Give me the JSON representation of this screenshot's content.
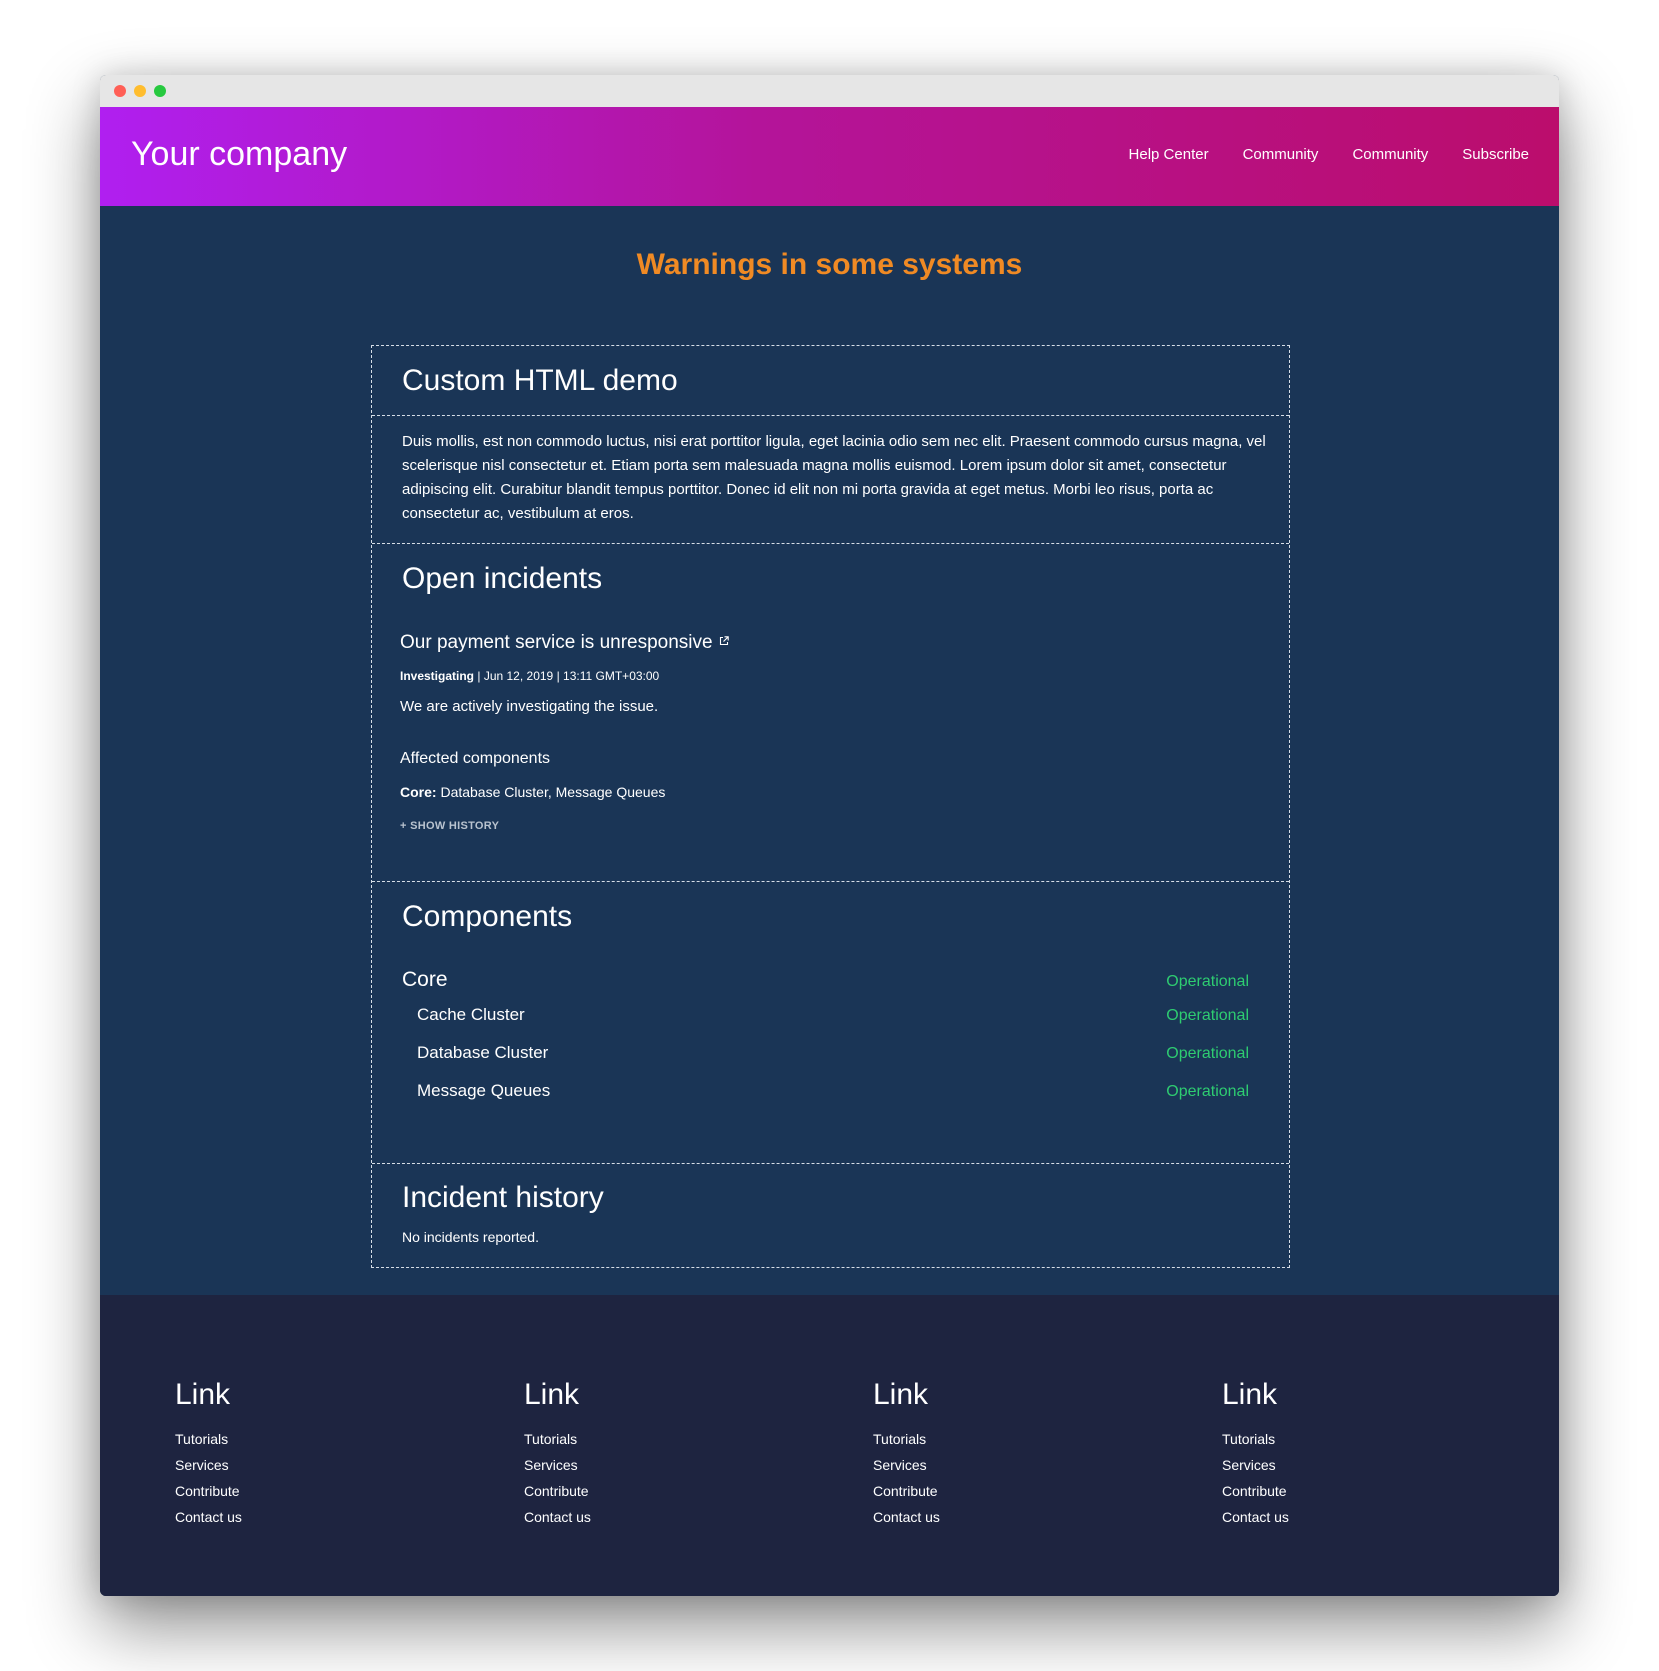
{
  "header": {
    "brand": "Your company",
    "nav": [
      "Help Center",
      "Community",
      "Community",
      "Subscribe"
    ]
  },
  "status": {
    "title": "Warnings in some systems",
    "color": "#f08a24"
  },
  "custom": {
    "title": "Custom HTML demo",
    "body": "Duis mollis, est non commodo luctus, nisi erat porttitor ligula, eget lacinia odio sem nec elit. Praesent commodo cursus magna, vel scelerisque nisl consectetur et. Etiam porta sem malesuada magna mollis euismod. Lorem ipsum dolor sit amet, consectetur adipiscing elit. Curabitur blandit tempus porttitor. Donec id elit non mi porta gravida at eget metus. Morbi leo risus, porta ac consectetur ac, vestibulum at eros."
  },
  "incidents": {
    "title": "Open incidents",
    "items": [
      {
        "name": "Our payment service is unresponsive",
        "icon": "external-link-icon",
        "state": "Investigating",
        "sep1": "|",
        "date": "Jun 12, 2019",
        "sep2": "|",
        "time": "13:11 GMT+03:00",
        "message": "We are actively investigating the issue.",
        "affected_title": "Affected components",
        "affected_group": "Core:",
        "affected_components": "Database Cluster, Message Queues",
        "show_history": "+ SHOW HISTORY"
      }
    ]
  },
  "components": {
    "title": "Components",
    "status_color": "#2ecc71",
    "items": [
      {
        "name": "Core",
        "status": "Operational"
      },
      {
        "name": "Cache Cluster",
        "status": "Operational"
      },
      {
        "name": "Database Cluster",
        "status": "Operational"
      },
      {
        "name": "Message Queues",
        "status": "Operational"
      }
    ]
  },
  "history": {
    "title": "Incident history",
    "empty": "No incidents reported."
  },
  "footer": {
    "columns": [
      {
        "title": "Link",
        "links": [
          "Tutorials",
          "Services",
          "Contribute",
          "Contact us"
        ]
      },
      {
        "title": "Link",
        "links": [
          "Tutorials",
          "Services",
          "Contribute",
          "Contact us"
        ]
      },
      {
        "title": "Link",
        "links": [
          "Tutorials",
          "Services",
          "Contribute",
          "Contact us"
        ]
      },
      {
        "title": "Link",
        "links": [
          "Tutorials",
          "Services",
          "Contribute",
          "Contact us"
        ]
      }
    ]
  }
}
